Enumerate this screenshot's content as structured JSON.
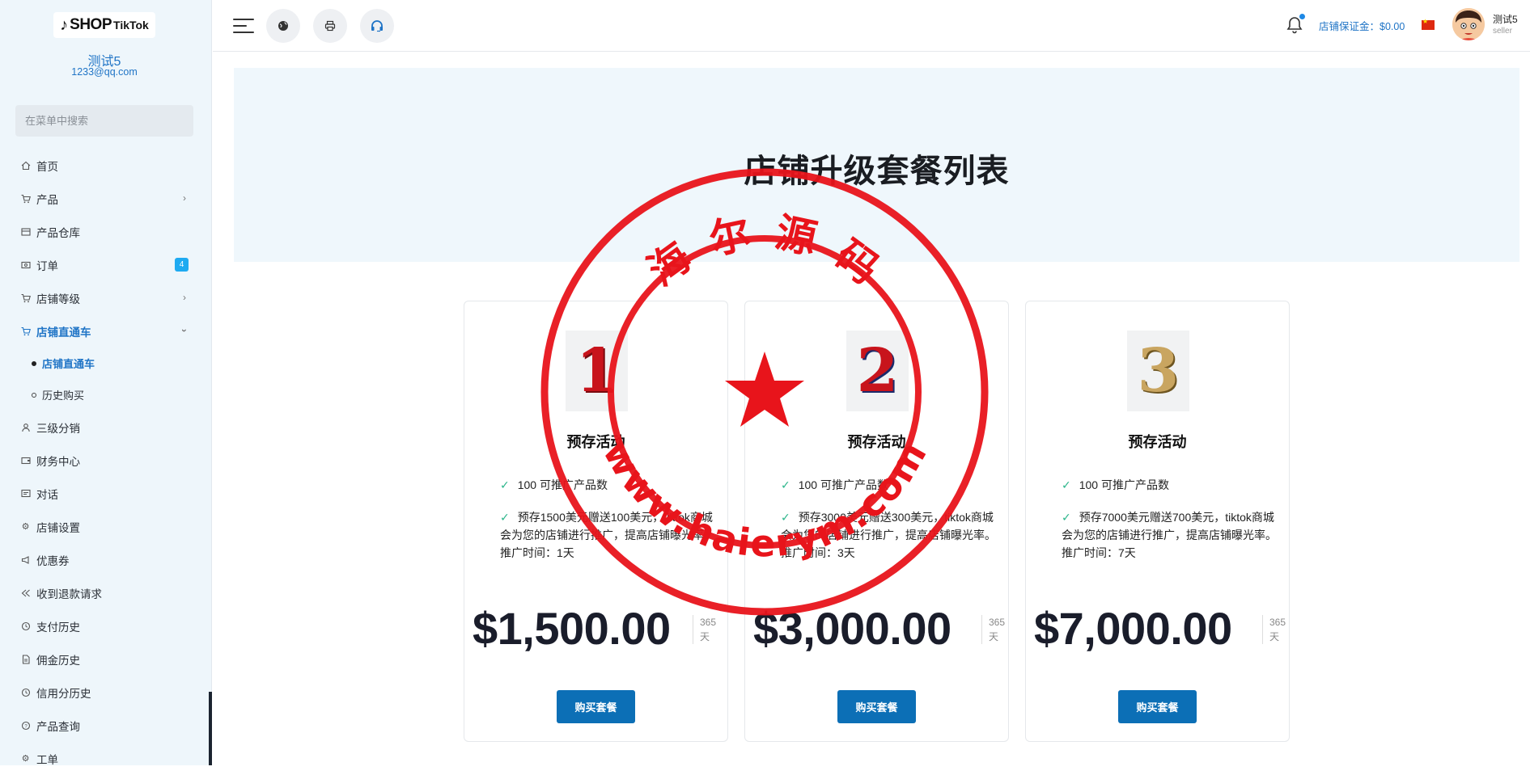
{
  "sidebar": {
    "logo_text_1": "SHOP",
    "logo_text_2": "TikTok",
    "user_name": "测试5",
    "user_email": "1233@qq.com",
    "search_placeholder": "在菜单中搜索",
    "items": [
      {
        "label": "首页",
        "icon": "home-icon"
      },
      {
        "label": "产品",
        "icon": "cart-icon"
      },
      {
        "label": "产品仓库",
        "icon": "warehouse-icon"
      },
      {
        "label": "订单",
        "icon": "order-icon",
        "badge": "4"
      },
      {
        "label": "店铺等级",
        "icon": "cart-icon"
      },
      {
        "label": "店铺直通车",
        "icon": "cart-icon"
      },
      {
        "label": "店铺直通车"
      },
      {
        "label": "历史购买"
      },
      {
        "label": "三级分销",
        "icon": "user-icon"
      },
      {
        "label": "财务中心",
        "icon": "finance-icon"
      },
      {
        "label": "对话",
        "icon": "chat-icon"
      },
      {
        "label": "店铺设置",
        "icon": "gear-icon"
      },
      {
        "label": "优惠券",
        "icon": "megaphone-icon"
      },
      {
        "label": "收到退款请求",
        "icon": "refund-icon"
      },
      {
        "label": "支付历史",
        "icon": "history-icon"
      },
      {
        "label": "佣金历史",
        "icon": "document-icon"
      },
      {
        "label": "信用分历史",
        "icon": "history-icon"
      },
      {
        "label": "产品查询",
        "icon": "help-icon"
      },
      {
        "label": "工单",
        "icon": "gear-icon"
      }
    ]
  },
  "header": {
    "deposit_label": "店铺保证金：$0.00",
    "user_name": "测试5",
    "user_role": "seller"
  },
  "banner": {
    "title": "店铺升级套餐列表"
  },
  "packages": [
    {
      "number": "1",
      "title": "预存活动",
      "feature1": "100 可推广产品数",
      "feature2": "预存1500美元赠送100美元，tiktok商城会为您的店铺进行推广，提高店铺曝光率。推广时间：1天",
      "price": "$1,500.00",
      "period_value": "365",
      "period_unit": "天",
      "buy_label": "购买套餐"
    },
    {
      "number": "2",
      "title": "预存活动",
      "feature1": "100 可推广产品数",
      "feature2": "预存3000美元赠送300美元，tiktok商城会为您的店铺进行推广，提高店铺曝光率。推广时间：3天",
      "price": "$3,000.00",
      "period_value": "365",
      "period_unit": "天",
      "buy_label": "购买套餐"
    },
    {
      "number": "3",
      "title": "预存活动",
      "feature1": "100 可推广产品数",
      "feature2": "预存7000美元赠送700美元，tiktok商城会为您的店铺进行推广，提高店铺曝光率。推广时间：7天",
      "price": "$7,000.00",
      "period_value": "365",
      "period_unit": "天",
      "buy_label": "购买套餐"
    }
  ],
  "watermark": {
    "top_text": "海 尔 源 码",
    "bottom_text": "www.haierym.com"
  },
  "colors": {
    "accent": "#1f74c6",
    "button": "#0c6fb6",
    "badge": "#1eaaf1",
    "check": "#2bb58a",
    "seal": "#e8141b"
  }
}
